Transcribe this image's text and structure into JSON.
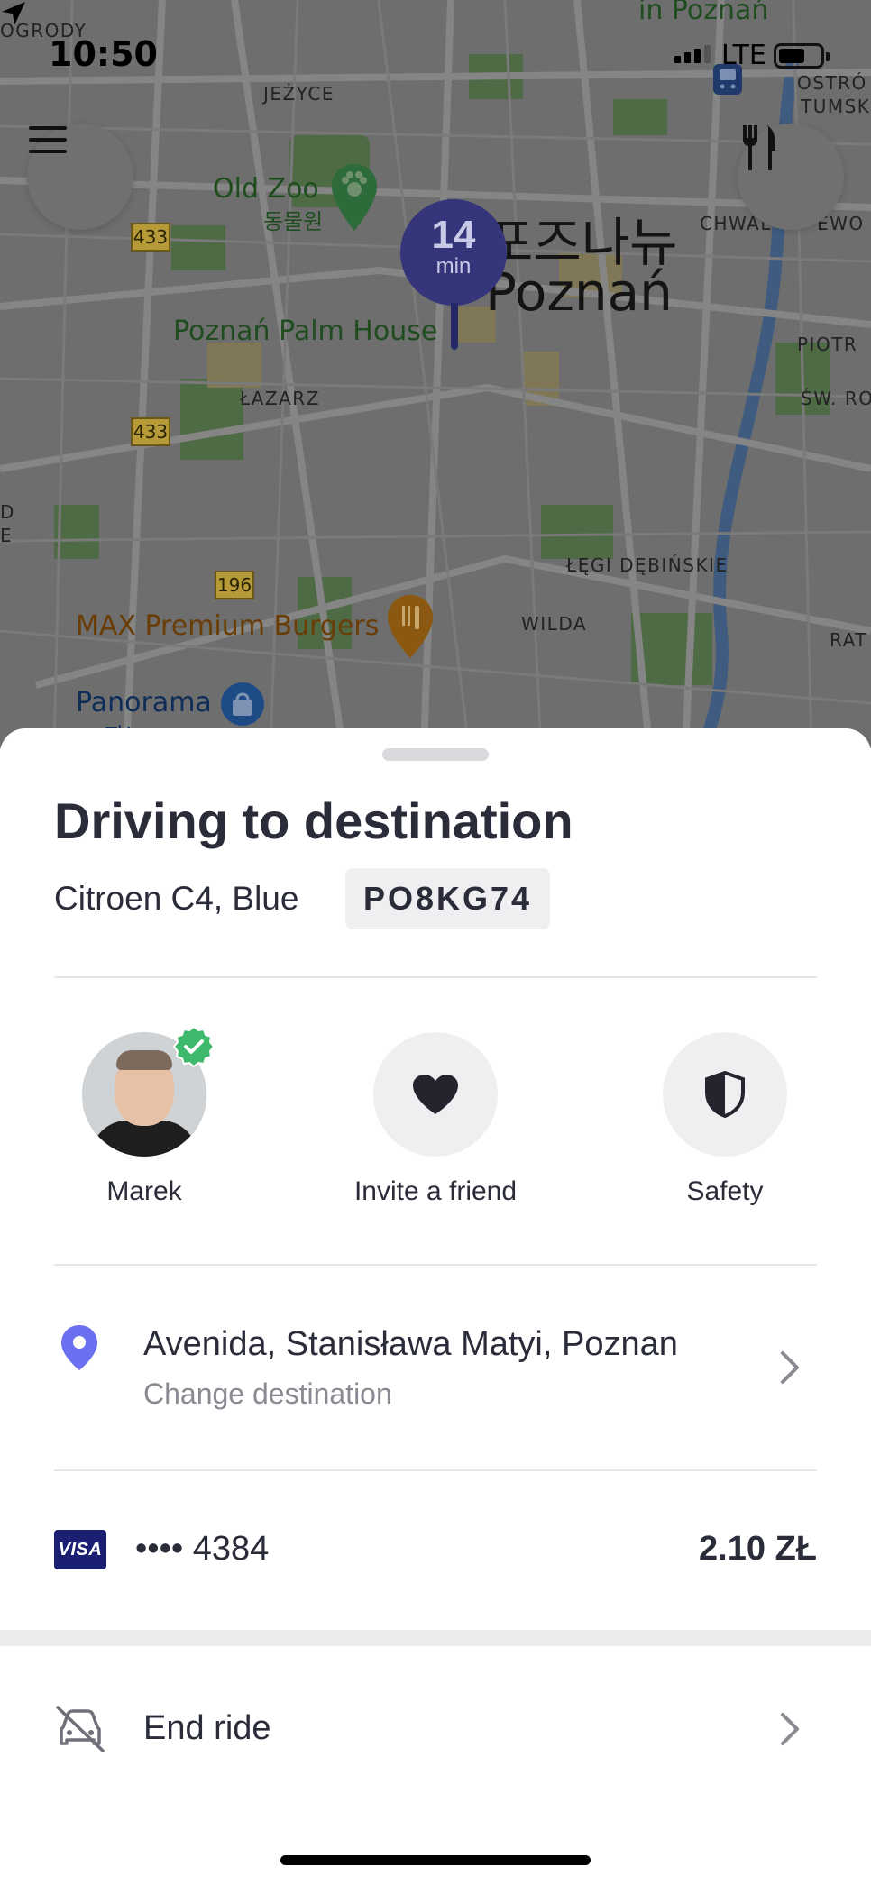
{
  "status_bar": {
    "time": "10:50",
    "network": "LTE"
  },
  "map": {
    "areas": [
      "JEŻYCE",
      "ŁAZARZ",
      "ŁĘGI DĘBIŃSKIE",
      "WILDA",
      "ŚW. ROCH",
      "PIOTR",
      "CHWAL",
      "EWO",
      "OSTRÓ",
      "TUMSK",
      "RAT",
      "OGRODY",
      "D",
      "E"
    ],
    "pois": {
      "zoo": "Old Zoo",
      "zoo_kr": "동물원",
      "palm_house": "Poznań Palm House",
      "burgers": "MAX Premium Burgers",
      "panorama": "Panorama",
      "panorama_kr": "파노",
      "city_kr": "포즈나뉴",
      "city": "Poznań",
      "top_partial": "in Poznań"
    },
    "routes": [
      "433",
      "433",
      "196"
    ]
  },
  "eta": {
    "value": "14",
    "unit": "min"
  },
  "ride": {
    "title": "Driving to destination",
    "car": "Citroen C4, Blue",
    "plate": "PO8KG74"
  },
  "actions": {
    "driver_name": "Marek",
    "invite_label": "Invite a friend",
    "safety_label": "Safety"
  },
  "destination": {
    "address": "Avenida, Stanisława Matyi, Poznan",
    "change_label": "Change destination"
  },
  "payment": {
    "card_brand": "VISA",
    "card_masked": "•••• 4384",
    "price": "2.10 ZŁ"
  },
  "end_ride": {
    "label": "End ride"
  },
  "colors": {
    "accent": "#6b6ff0",
    "verified": "#3eb86a",
    "text": "#2a2c3a",
    "muted": "#8a8a92"
  }
}
